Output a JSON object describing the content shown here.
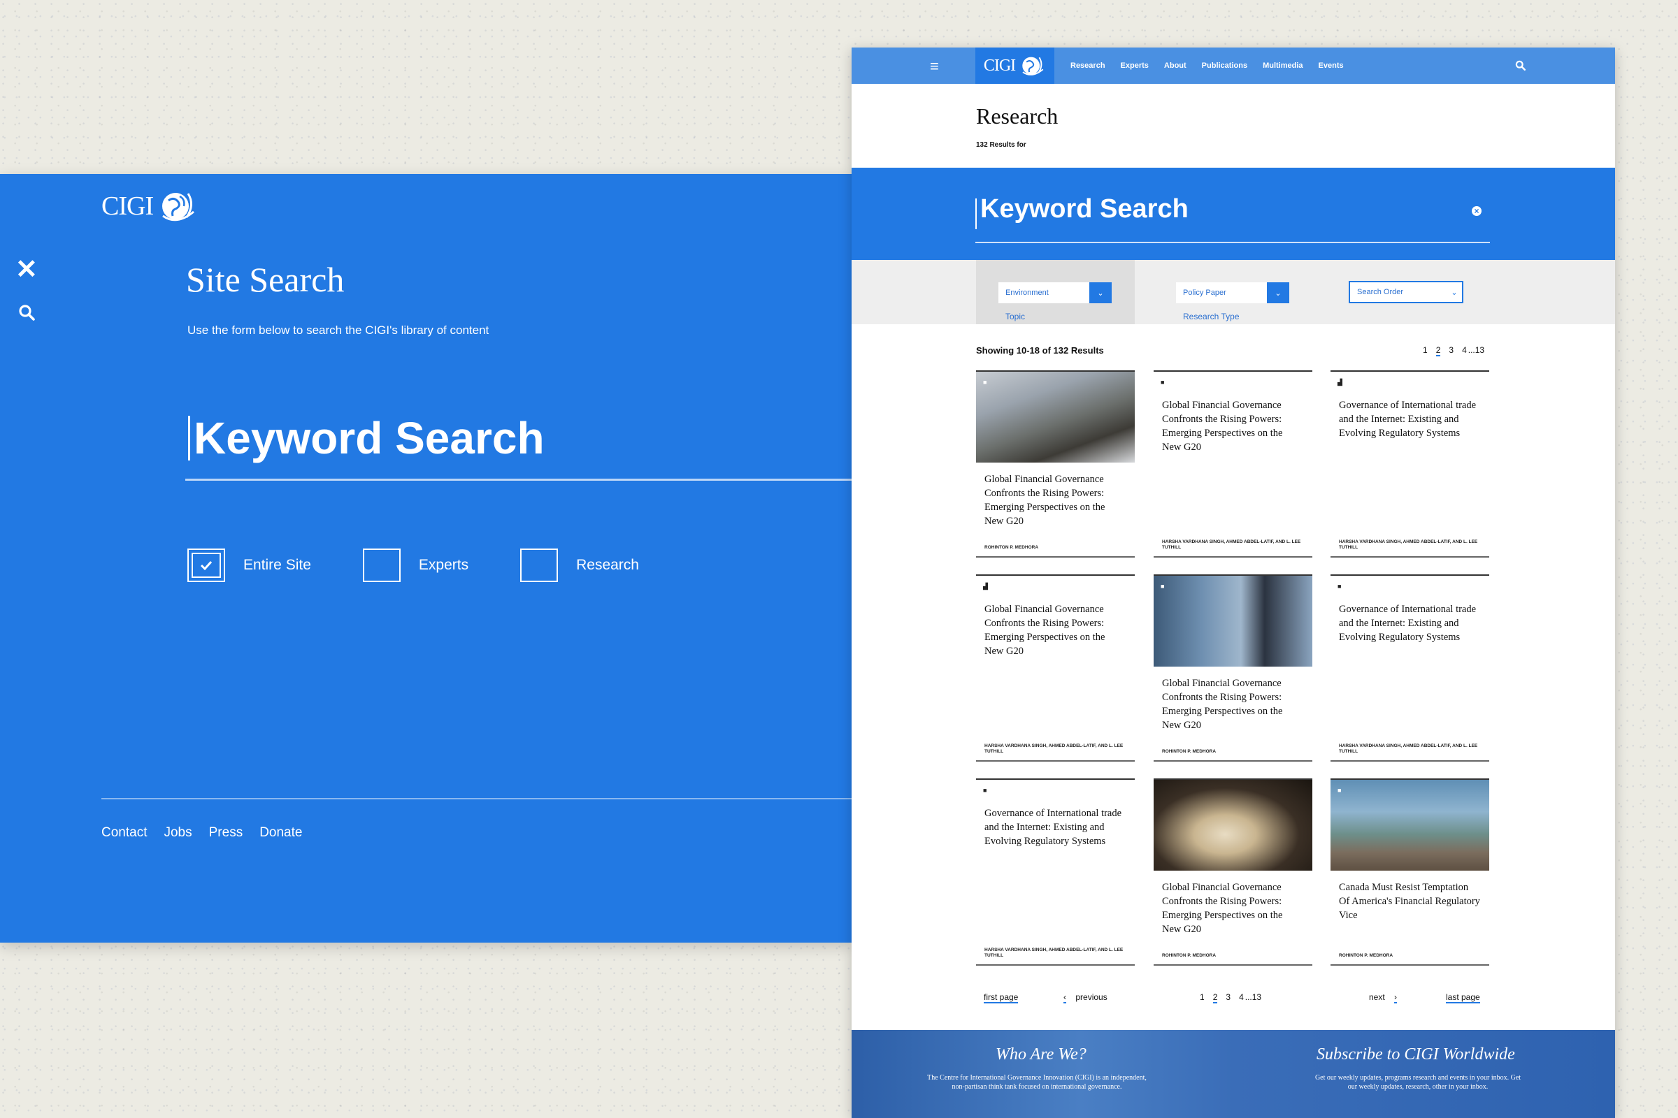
{
  "brand": {
    "logo_text": "CIGI"
  },
  "overlay": {
    "title": "Site Search",
    "subtitle": "Use the form below to search the CIGI's library of content",
    "keyword_value": "Keyword Search",
    "checkboxes": [
      {
        "label": "Entire Site",
        "checked": true
      },
      {
        "label": "Experts",
        "checked": false
      },
      {
        "label": "Research",
        "checked": false
      }
    ],
    "footer_links": [
      "Contact",
      "Jobs",
      "Press",
      "Donate"
    ]
  },
  "nav": {
    "links": [
      "Research",
      "Experts",
      "About",
      "Publications",
      "Multimedia",
      "Events"
    ]
  },
  "page": {
    "title": "Research",
    "results_text": "132 Results for",
    "keyword_value": "Keyword Search",
    "filters": {
      "topic_value": "Environment",
      "topic_label": "Topic",
      "type_value": "Policy Paper",
      "type_label": "Research Type",
      "order_value": "Search Order"
    },
    "showing": "Showing 10-18 of 132 Results",
    "pagination": {
      "pages": [
        "1",
        "2",
        "3",
        "4",
        "...13"
      ],
      "current": "2"
    },
    "cards": [
      {
        "title": "Global Financial Governance Confronts the Rising Powers: Emerging Perspectives on the New G20",
        "author": "Rohinton P. Medhora"
      },
      {
        "title": "Global Financial Governance Confronts the Rising Powers: Emerging Perspectives on the New G20",
        "author": "Harsha Vardhana Singh, Ahmed Abdel-Latif, and L. Lee Tuthill"
      },
      {
        "title": "Governance of International trade and the Internet: Existing and Evolving Regulatory Systems",
        "author": "Harsha Vardhana Singh, Ahmed Abdel-Latif, and L. Lee Tuthill"
      },
      {
        "title": "Global Financial Governance Confronts the Rising Powers: Emerging Perspectives on the New G20",
        "author": "Harsha Vardhana Singh, Ahmed Abdel-Latif, and L. Lee Tuthill"
      },
      {
        "title": "Global Financial Governance Confronts the Rising Powers: Emerging Perspectives on the New G20",
        "author": "Rohinton P. Medhora"
      },
      {
        "title": "Governance of International trade and the Internet: Existing and Evolving Regulatory Systems",
        "author": "Harsha Vardhana Singh, Ahmed Abdel-Latif, and L. Lee Tuthill"
      },
      {
        "title": "Governance of International trade and the Internet: Existing and Evolving Regulatory Systems",
        "author": "Harsha Vardhana Singh, Ahmed Abdel-Latif, and L. Lee Tuthill"
      },
      {
        "title": "Global Financial Governance Confronts the Rising Powers: Emerging Perspectives on the New G20",
        "author": "Rohinton P. Medhora"
      },
      {
        "title": "Canada Must Resist Temptation Of America's Financial Regulatory Vice",
        "author": "Rohinton P. Medhora"
      }
    ],
    "bottom_pagination": {
      "first": "first page",
      "previous": "previous",
      "pages": [
        "1",
        "2",
        "3",
        "4",
        "...13"
      ],
      "next": "next",
      "last": "last page"
    },
    "footer": {
      "who_title": "Who Are We?",
      "who_text": "The Centre for International Governance Innovation (CIGI) is an independent, non-partisan think tank focused on international governance.",
      "subscribe_title": "Subscribe to CIGI Worldwide",
      "subscribe_text": "Get our weekly updates, programs research and events in your inbox. Get our weekly updates, research, other in your inbox."
    }
  },
  "colors": {
    "primary": "#2279e3",
    "nav": "#4a90e2",
    "background": "#ecebe3"
  }
}
